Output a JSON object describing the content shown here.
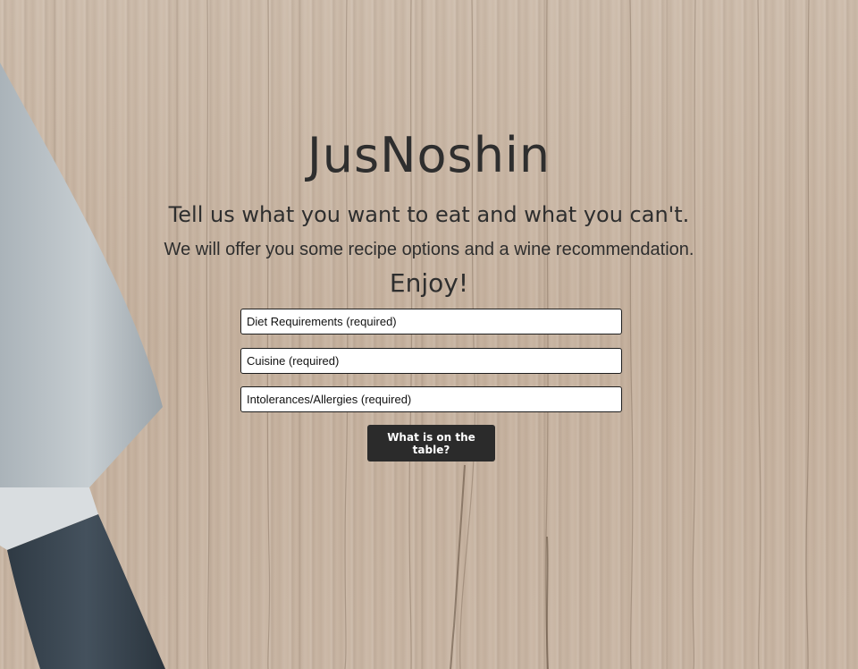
{
  "header": {
    "title": "JusNoshin",
    "tagline": "Tell us what you want to eat and what you can't.",
    "subline": "We will offer you some recipe options and a wine recommendation.",
    "enjoy": "Enjoy!"
  },
  "form": {
    "diet": {
      "placeholder": "Diet Requirements (required)",
      "value": ""
    },
    "cuisine": {
      "placeholder": "Cuisine (required)",
      "value": ""
    },
    "intolerances": {
      "placeholder": "Intolerances/Allergies (required)",
      "value": ""
    },
    "submit_label": "What is on the table?"
  },
  "background": {
    "image": "wooden-table-with-chef-knife",
    "wood_color": "#c8b5a3",
    "blade_color": "#b9c1c6",
    "handle_color": "#3a4651"
  }
}
